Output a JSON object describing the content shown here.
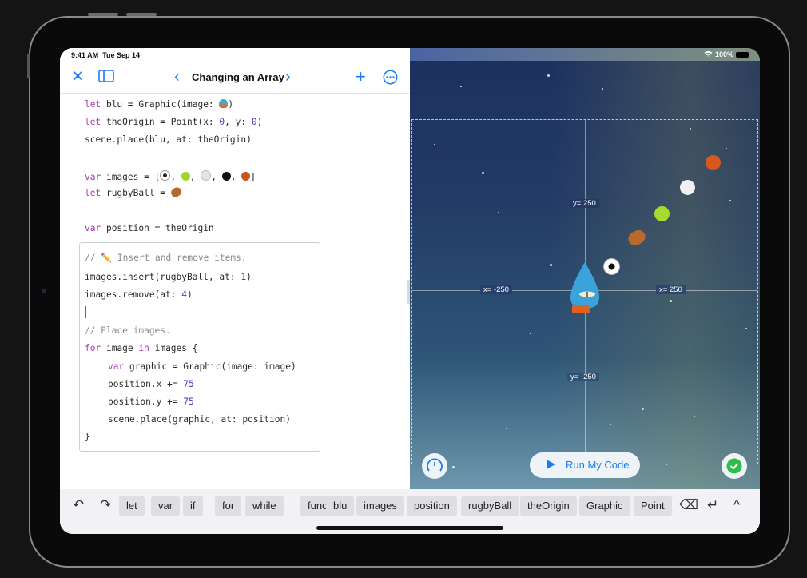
{
  "status": {
    "time": "9:41 AM",
    "date": "Tue Sep 14",
    "battery": "100%"
  },
  "navbar": {
    "title": "Changing an Array",
    "icons": [
      "close-icon",
      "sidebar-icon",
      "chevron-left-icon",
      "chevron-right-icon",
      "plus-icon",
      "more-icon"
    ]
  },
  "code": {
    "line1": {
      "kw": "let",
      "rest": " blu = Graphic(image: ",
      "end": ")"
    },
    "line2": {
      "kw": "let",
      "pre": " theOrigin = Point(x: ",
      "n1": "0",
      "mid": ", y: ",
      "n2": "0",
      "end": ")"
    },
    "line3": "scene.place(blu, at: theOrigin)",
    "line4": {
      "kw": "var",
      "rest": " images = [",
      "end": "]"
    },
    "line5": {
      "kw": "let",
      "rest": " rugbyBall = "
    },
    "line6": {
      "kw": "var",
      "rest": " position = theOrigin"
    },
    "comment1": "// ✏️ Insert and remove items.",
    "line7": {
      "pre": "images.insert(rugbyBall, at: ",
      "n": "1",
      "end": ")"
    },
    "line8": {
      "pre": "images.remove(at: ",
      "n": "4",
      "end": ")"
    },
    "comment2": "// Place images.",
    "line9": {
      "kw1": "for",
      "mid": " image ",
      "kw2": "in",
      "end": " images {"
    },
    "line10": {
      "kw": "var",
      "rest": " graphic = Graphic(image: image)"
    },
    "line11": {
      "pre": "position.x += ",
      "n": "75"
    },
    "line12": {
      "pre": "position.y += ",
      "n": "75"
    },
    "line13": "scene.place(graphic, at: position)",
    "line14": "}",
    "images_array": [
      "soccer-ball",
      "tennis-ball",
      "baseball",
      "8-ball",
      "basketball"
    ],
    "rugby_ball": "rugby-ball"
  },
  "scene": {
    "labels": {
      "y_pos": "y= 250",
      "y_neg": "y= -250",
      "x_neg": "x= -250",
      "x_pos": "x= 250"
    },
    "balls": [
      "soccer-ball",
      "rugby-ball",
      "tennis-ball",
      "baseball",
      "basketball"
    ],
    "run_button": "Run My Code"
  },
  "toolbar": {
    "chips": [
      "let",
      "var",
      "if",
      "for",
      "while",
      "func",
      "blu",
      "images",
      "position",
      "rugbyBall",
      "theOrigin",
      "Graphic",
      "Point"
    ]
  }
}
